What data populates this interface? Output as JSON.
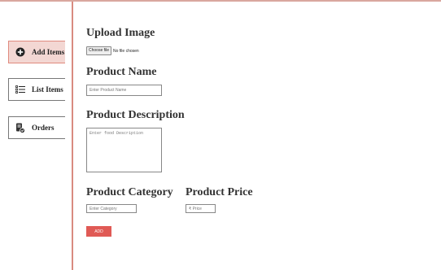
{
  "sidebar": {
    "items": [
      {
        "label": "Add Items",
        "icon": "add-circle-icon",
        "active": true
      },
      {
        "label": "List Items",
        "icon": "list-icon",
        "active": false
      },
      {
        "label": "Orders",
        "icon": "orders-icon",
        "active": false
      }
    ]
  },
  "form": {
    "upload_title": "Upload Image",
    "file_button": "Choose file",
    "file_status": "No file chosen",
    "name_title": "Product Name",
    "name_placeholder": "Enter Product Name",
    "description_title": "Product Description",
    "description_placeholder": "Enter food Description",
    "category_title": "Product Category",
    "category_placeholder": "Enter Category",
    "price_title": "Product Price",
    "price_placeholder": "₹ Price",
    "add_button": "ADD"
  },
  "colors": {
    "accent": "#e05a55",
    "sidebar_border": "#d98b80",
    "active_item_bg": "#f3d7d3"
  }
}
